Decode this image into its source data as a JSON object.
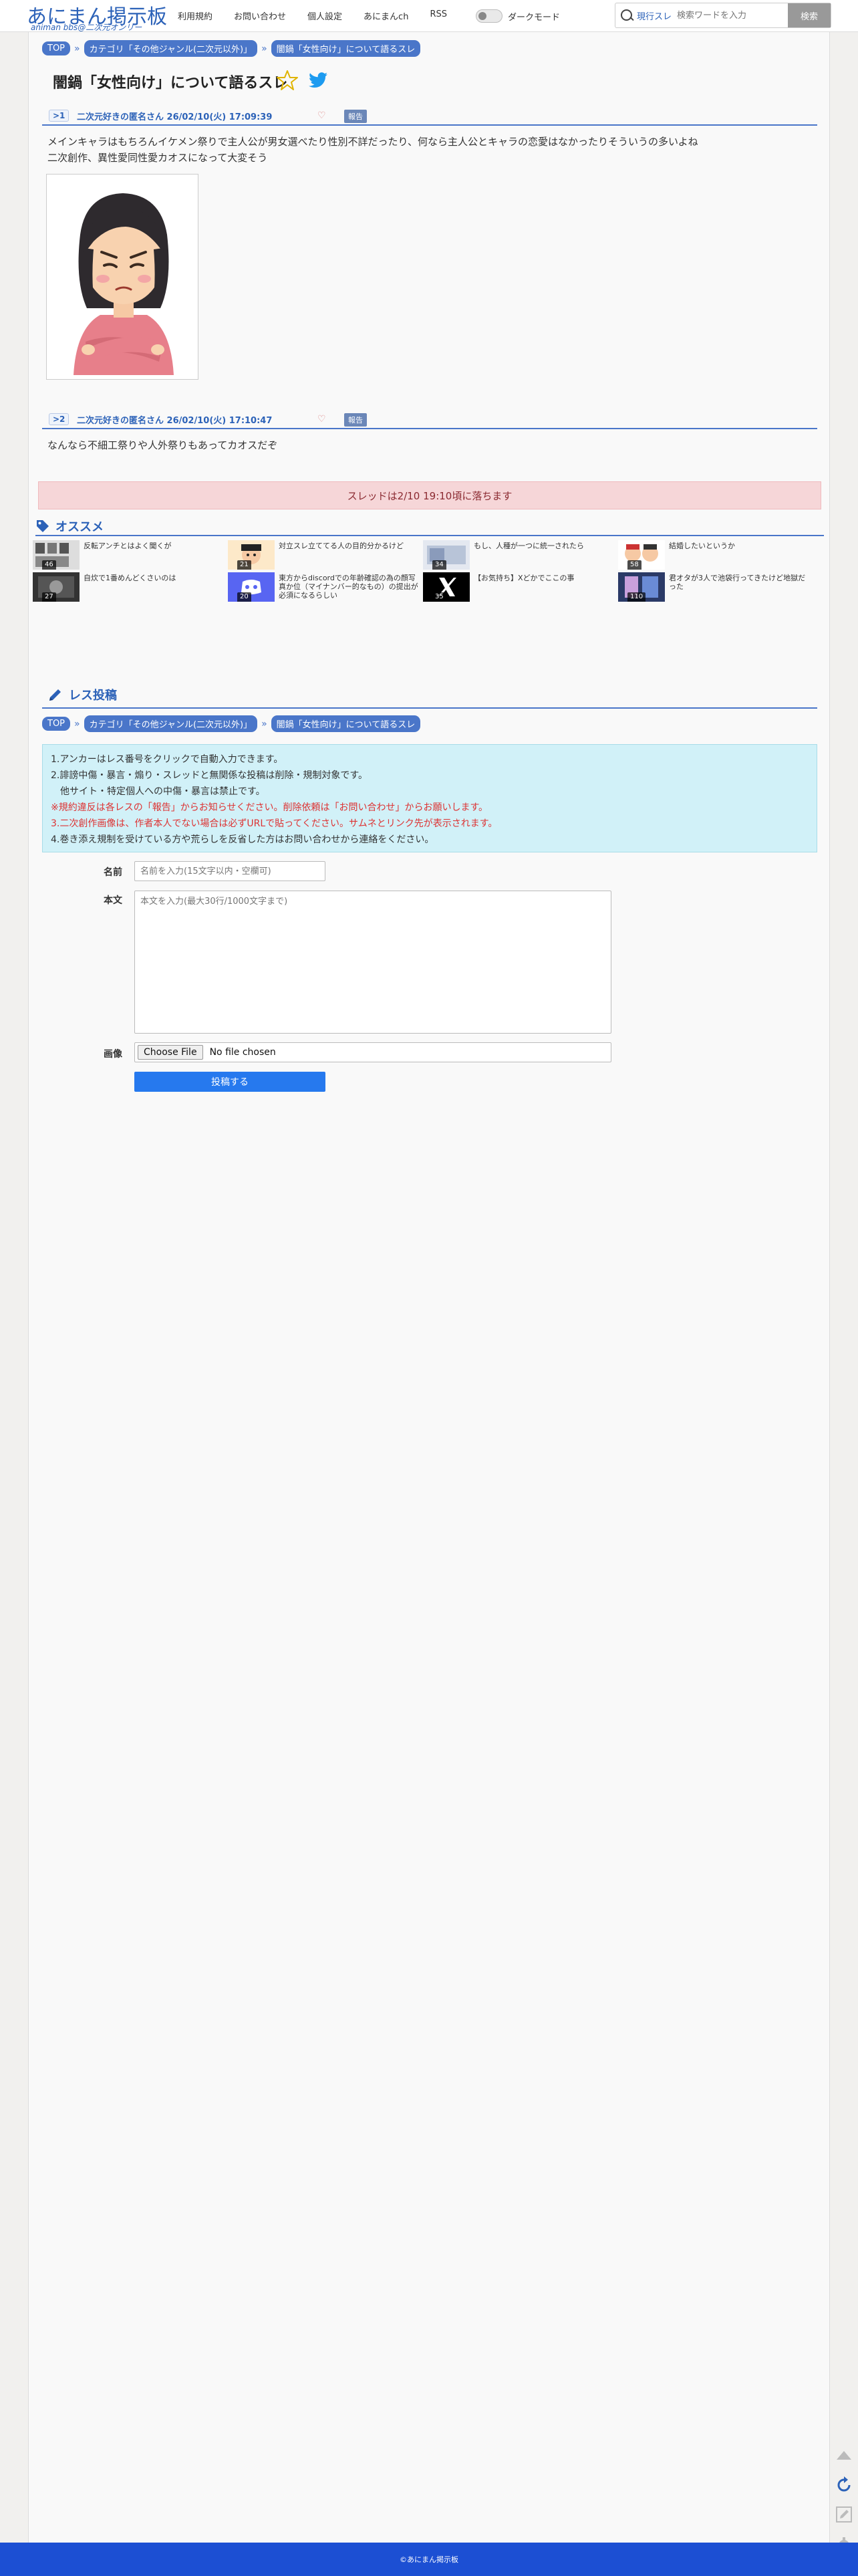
{
  "header": {
    "logo_main": "あにまん掲示板",
    "logo_sub": "animan bbs@二次元オンリー",
    "nav": [
      "利用規約",
      "お問い合わせ",
      "個人設定",
      "あにまんch",
      "RSS"
    ],
    "dark_mode_label": "ダークモード",
    "search_scope": "現行スレ",
    "search_placeholder": "検索ワードを入力",
    "search_button": "検索"
  },
  "breadcrumb": [
    "TOP",
    "カテゴリ「その他ジャンル(二次元以外)」",
    "闇鍋「女性向け」について語るスレ"
  ],
  "thread_title": "闇鍋「女性向け」について語るスレ",
  "posts": [
    {
      "anchor": ">1",
      "poster": "二次元好きの匿名さん",
      "datetime": "26/02/10(火) 17:09:39",
      "report": "報告",
      "lines": [
        "メインキャラはもちろんイケメン祭りで主人公が男女選べたり性別不詳だったり、何なら主人公とキャラの恋愛はなかったりそういうの多いよね",
        "二次創作、異性愛同性愛カオスになって大変そう"
      ]
    },
    {
      "anchor": ">2",
      "poster": "二次元好きの匿名さん",
      "datetime": "26/02/10(火) 17:10:47",
      "report": "報告",
      "lines": [
        "なんなら不細工祭りや人外祭りもあってカオスだぞ"
      ]
    }
  ],
  "alert_text": "スレッドは2/10 19:10頃に落ちます",
  "recommend": {
    "title": "オススメ",
    "items": [
      {
        "count": "46",
        "title": "反転アンチとはよく聞くが"
      },
      {
        "count": "21",
        "title": "対立スレ立ててる人の目的分かるけど"
      },
      {
        "count": "34",
        "title": "もし、人種が一つに統一されたら"
      },
      {
        "count": "58",
        "title": "結婚したいというか"
      },
      {
        "count": "27",
        "title": "自炊で1番めんどくさいのは"
      },
      {
        "count": "20",
        "title": "東方からdiscordでの年齢確認の為の顔写真か位（マイナンバー的なもの）の提出が必須になるらしい"
      },
      {
        "count": "35",
        "title": "【お気持ち】Xどかでここの事"
      },
      {
        "count": "110",
        "title": "君オタが3人で池袋行ってきたけど地獄だった"
      }
    ]
  },
  "form": {
    "title": "レス投稿",
    "notice": [
      "1.アンカーはレス番号をクリックで自動入力できます。",
      "2.誹謗中傷・暴言・煽り・スレッドと無関係な投稿は削除・規制対象です。",
      "　他サイト・特定個人への中傷・暴言は禁止です。",
      "※規約違反は各レスの「報告」からお知らせください。削除依頼は「お問い合わせ」からお願いします。",
      "3.二次創作画像は、作者本人でない場合は必ずURLで貼ってください。サムネとリンク先が表示されます。",
      "4.巻き添え規制を受けている方や荒らしを反省した方はお問い合わせから連絡をください。"
    ],
    "name_label": "名前",
    "name_placeholder": "名前を入力(15文字以内・空欄可)",
    "body_label": "本文",
    "body_placeholder": "本文を入力(最大30行/1000文字まで)",
    "image_label": "画像",
    "file_button": "Choose File",
    "file_status": "No file chosen",
    "submit": "投稿する"
  },
  "footer": "©あにまん掲示板",
  "colors": {
    "accent": "#4a76c9",
    "alert_bg": "#f6d6d8",
    "notice_bg": "#d1f1f8",
    "submit": "#2679ee",
    "footer": "#1c4fd3"
  }
}
